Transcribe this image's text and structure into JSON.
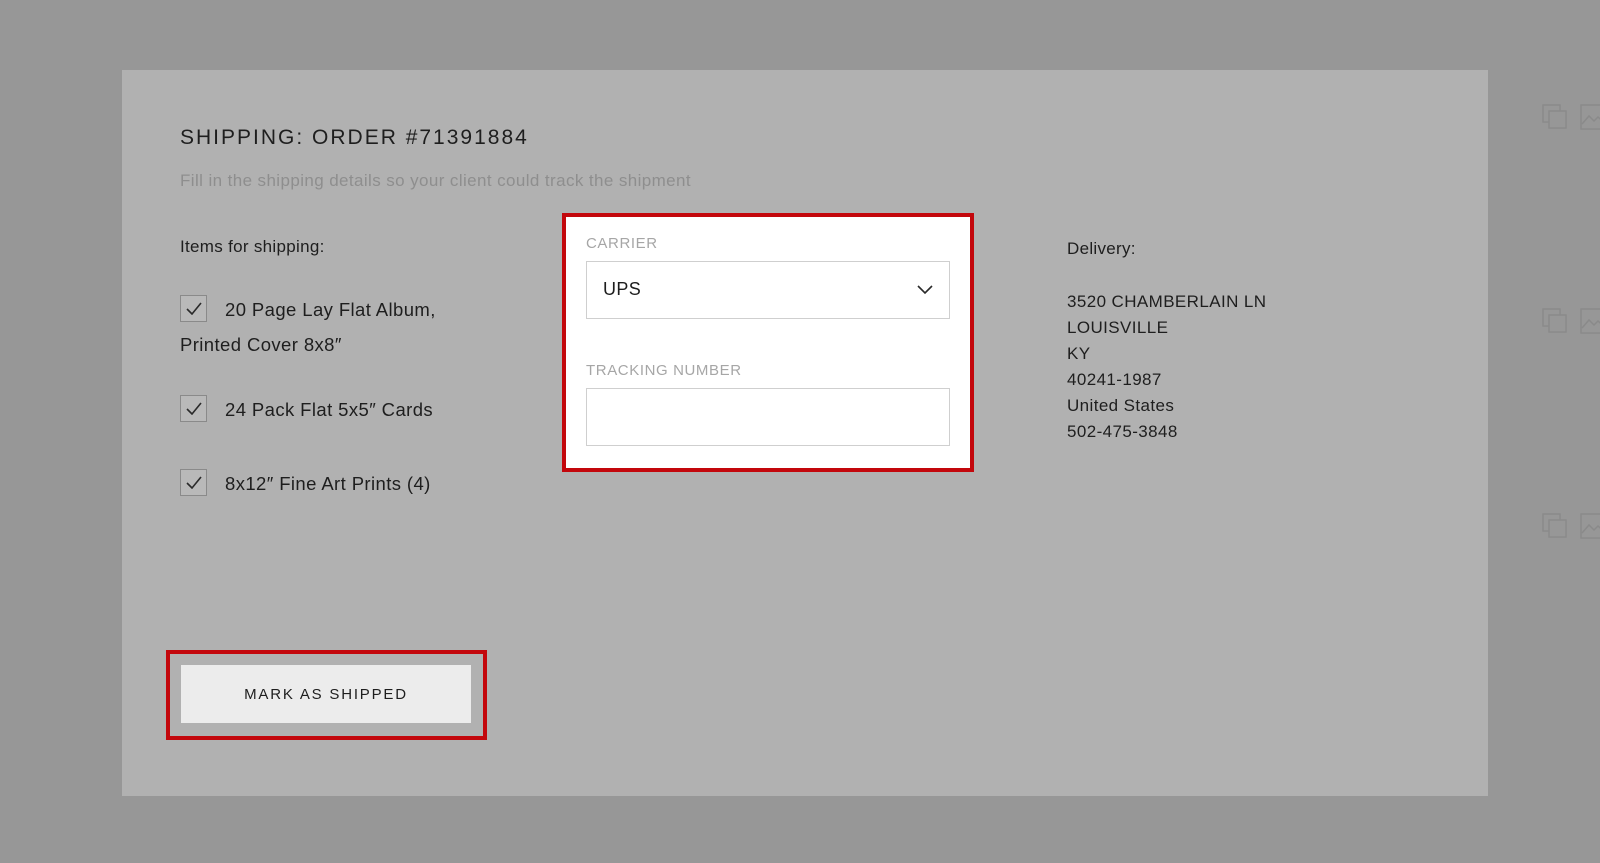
{
  "modal": {
    "title": "SHIPPING: ORDER #71391884",
    "subtitle": "Fill in the shipping details so your client could track the shipment"
  },
  "items": {
    "heading": "Items for shipping:",
    "list": [
      {
        "label": "20 Page Lay Flat Album, Printed Cover 8x8″",
        "checked": true
      },
      {
        "label": "24 Pack Flat 5x5″ Cards",
        "checked": true
      },
      {
        "label": "8x12″ Fine Art Prints (4)",
        "checked": true
      }
    ]
  },
  "form": {
    "carrier_label": "CARRIER",
    "carrier_value": "UPS",
    "tracking_label": "TRACKING NUMBER",
    "tracking_value": ""
  },
  "delivery": {
    "heading": "Delivery:",
    "address_lines": [
      "3520 CHAMBERLAIN LN",
      "LOUISVILLE",
      "KY",
      "40241-1987",
      "United States",
      "502-475-3848"
    ]
  },
  "actions": {
    "mark_shipped_label": "MARK AS SHIPPED"
  },
  "colors": {
    "overlay": "#979797",
    "modal_bg": "#b1b1b1",
    "highlight": "#c3070c"
  }
}
